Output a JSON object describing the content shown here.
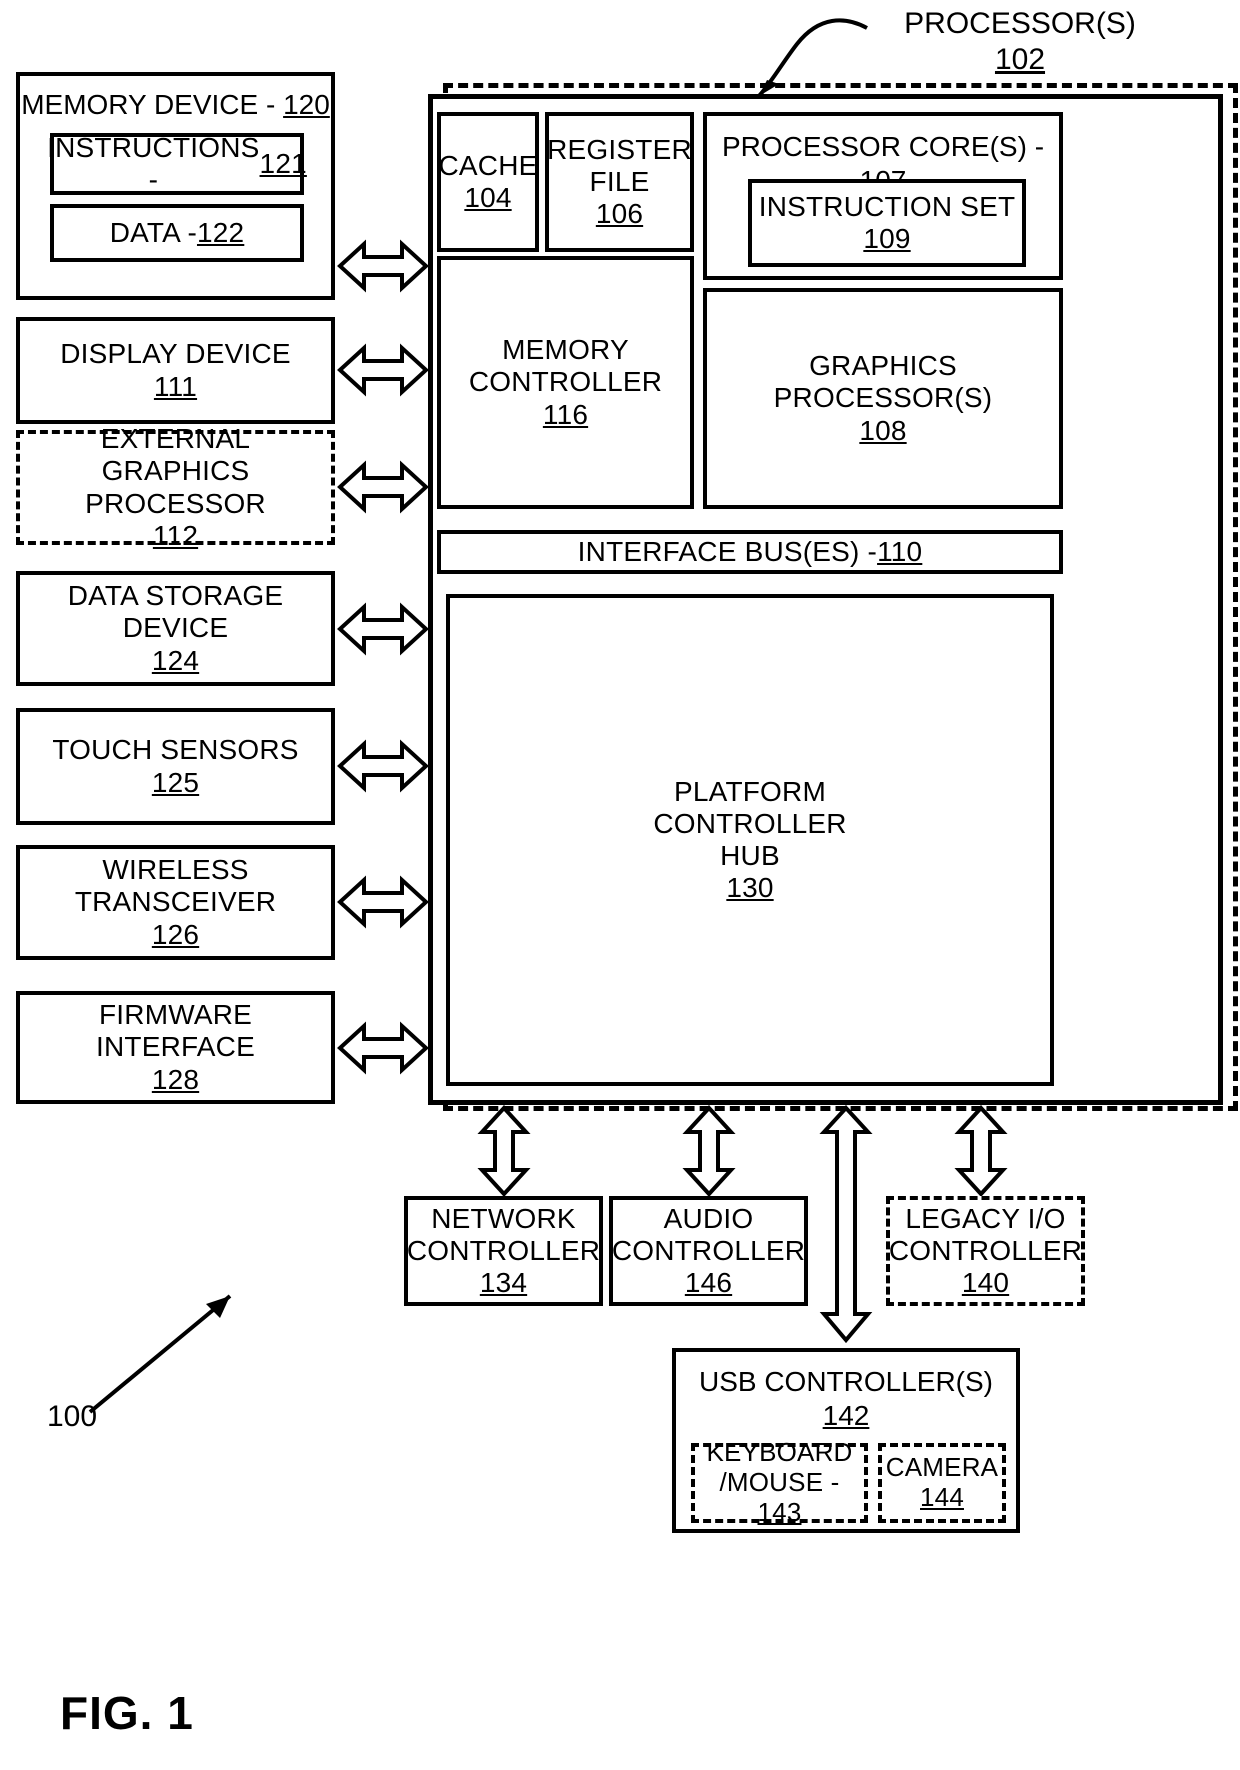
{
  "figure": {
    "caption": "FIG. 1",
    "system_ref": "100"
  },
  "processor": {
    "label": "PROCESSOR(S)",
    "ref": "102"
  },
  "left_column": [
    {
      "name": "memory-device",
      "title": "MEMORY DEVICE - ",
      "ref": "120",
      "children": [
        {
          "name": "instructions",
          "title": "INSTRUCTIONS - ",
          "ref": "121"
        },
        {
          "name": "data",
          "title": "DATA - ",
          "ref": "122"
        }
      ]
    },
    {
      "name": "display-device",
      "line1": "DISPLAY DEVICE",
      "ref": "111",
      "dashed": false
    },
    {
      "name": "external-graphics-processor",
      "line1": "EXTERNAL",
      "line2": "GRAPHICS PROCESSOR",
      "ref": "112",
      "dashed": true
    },
    {
      "name": "data-storage-device",
      "line1": "DATA STORAGE",
      "line2": "DEVICE",
      "ref": "124",
      "dashed": false
    },
    {
      "name": "touch-sensors",
      "line1": "TOUCH SENSORS",
      "ref": "125",
      "dashed": false
    },
    {
      "name": "wireless-transceiver",
      "line1": "WIRELESS",
      "line2": "TRANSCEIVER",
      "ref": "126",
      "dashed": false
    },
    {
      "name": "firmware-interface",
      "line1": "FIRMWARE INTERFACE",
      "ref": "128",
      "dashed": false
    }
  ],
  "processor_blocks": {
    "cache": {
      "line1": "CACHE",
      "ref": "104"
    },
    "register_file": {
      "line1": "REGISTER",
      "line2": "FILE",
      "ref": "106"
    },
    "memory_controller": {
      "line1": "MEMORY",
      "line2": "CONTROLLER",
      "ref": "116"
    },
    "processor_cores": {
      "title": "PROCESSOR CORE(S) - ",
      "ref": "107"
    },
    "instruction_set": {
      "line1": "INSTRUCTION SET",
      "ref": "109"
    },
    "graphics_processor": {
      "line1": "GRAPHICS PROCESSOR(S)",
      "ref": "108"
    },
    "interface_bus": {
      "title": "INTERFACE BUS(ES) - ",
      "ref": "110"
    },
    "platform_controller_hub": {
      "line1": "PLATFORM",
      "line2": "CONTROLLER",
      "line3": "HUB",
      "ref": "130"
    }
  },
  "bottom_row": [
    {
      "name": "network-controller",
      "line1": "NETWORK",
      "line2": "CONTROLLER",
      "ref": "134",
      "dashed": false
    },
    {
      "name": "audio-controller",
      "line1": "AUDIO",
      "line2": "CONTROLLER",
      "ref": "146",
      "dashed": false
    },
    {
      "name": "legacy-io-controller",
      "line1": "LEGACY I/O",
      "line2": "CONTROLLER",
      "ref": "140",
      "dashed": true
    }
  ],
  "usb": {
    "title": "USB CONTROLLER(S)",
    "ref": "142",
    "children": [
      {
        "name": "keyboard-mouse",
        "line1": "KEYBOARD",
        "line2": "/MOUSE - ",
        "ref": "143",
        "inline_ref": true
      },
      {
        "name": "camera",
        "line1": "CAMERA",
        "ref": "144",
        "inline_ref": false
      }
    ]
  }
}
